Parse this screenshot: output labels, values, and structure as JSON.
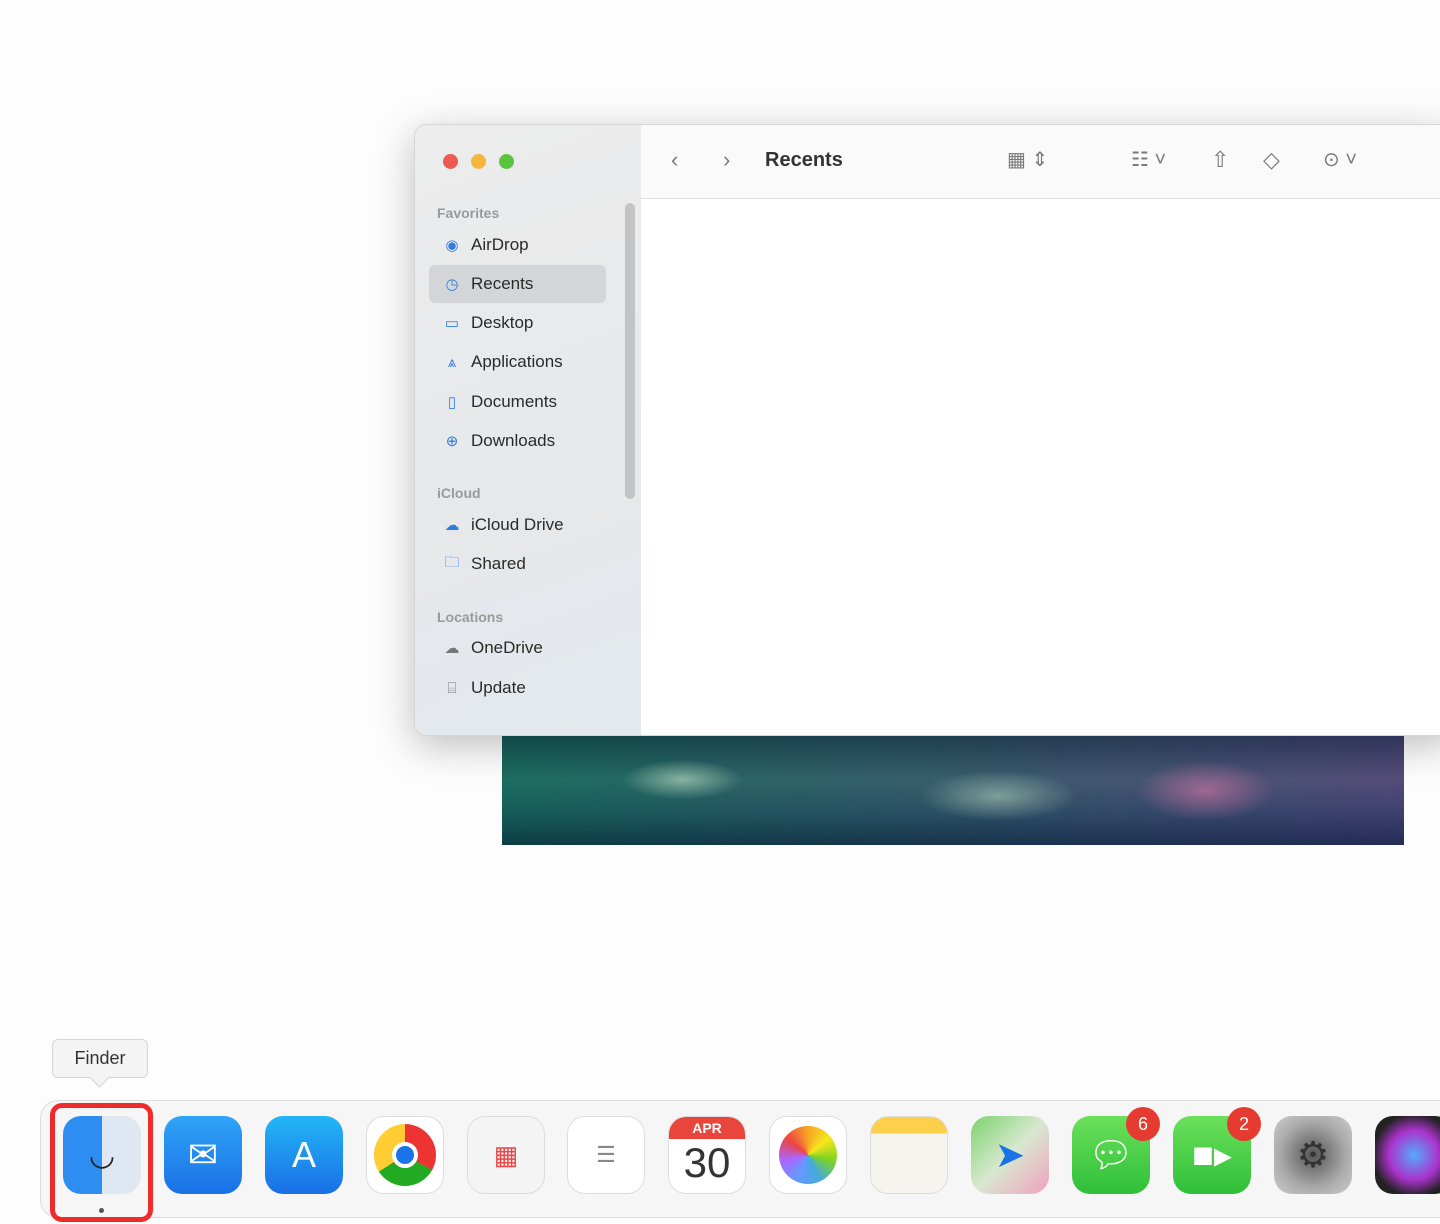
{
  "finder": {
    "title": "Recents",
    "sidebar": {
      "favorites_header": "Favorites",
      "icloud_header": "iCloud",
      "locations_header": "Locations",
      "favorites": [
        {
          "label": "AirDrop",
          "icon": "airdrop-icon"
        },
        {
          "label": "Recents",
          "icon": "clock-icon",
          "selected": true
        },
        {
          "label": "Desktop",
          "icon": "desktop-icon"
        },
        {
          "label": "Applications",
          "icon": "applications-icon"
        },
        {
          "label": "Documents",
          "icon": "document-icon"
        },
        {
          "label": "Downloads",
          "icon": "download-icon"
        }
      ],
      "icloud": [
        {
          "label": "iCloud Drive",
          "icon": "cloud-icon"
        },
        {
          "label": "Shared",
          "icon": "shared-folder-icon"
        }
      ],
      "locations": [
        {
          "label": "OneDrive",
          "icon": "cloud-icon"
        },
        {
          "label": "Update",
          "icon": "drive-icon"
        }
      ]
    }
  },
  "dock": {
    "tooltip": "Finder",
    "apps": [
      {
        "name": "Finder",
        "active": true
      },
      {
        "name": "Mail"
      },
      {
        "name": "App Store"
      },
      {
        "name": "Google Chrome"
      },
      {
        "name": "Launchpad"
      },
      {
        "name": "Reminders"
      },
      {
        "name": "Calendar",
        "month": "APR",
        "day": "30"
      },
      {
        "name": "Photos"
      },
      {
        "name": "Notes"
      },
      {
        "name": "Maps"
      },
      {
        "name": "Messages",
        "badge": "6"
      },
      {
        "name": "FaceTime",
        "badge": "2"
      },
      {
        "name": "System Settings"
      },
      {
        "name": "Siri"
      }
    ]
  },
  "highlight_color": "#ee2b2b"
}
